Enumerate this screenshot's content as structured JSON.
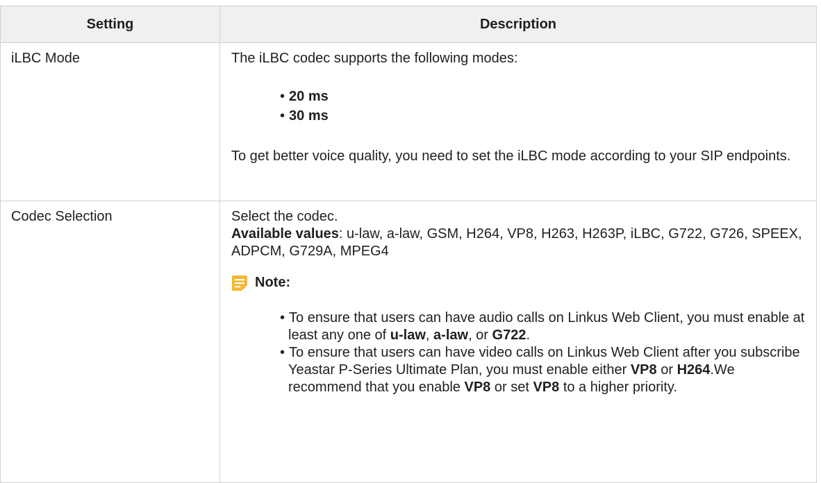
{
  "header": {
    "setting": "Setting",
    "description": "Description"
  },
  "rows": [
    {
      "setting": "iLBC Mode",
      "intro": "The iLBC codec supports the following modes:",
      "modes": [
        "20 ms",
        "30 ms"
      ],
      "after": "To get better voice quality, you need to set the iLBC mode according to your SIP endpoints."
    },
    {
      "setting": "Codec Selection",
      "intro": "Select the codec.",
      "available_label": "Available values",
      "available_values": ": u-law, a-law, GSM, H264, VP8, H263, H263P, iLBC, G722, G726, SPEEX, ADPCM, G729A, MPEG4",
      "note_label": "Note:",
      "note_icon": "note-icon",
      "note_icon_color": "#f5b82e",
      "note1": {
        "t1": "To ensure that users can have audio calls on Linkus Web Client, you must enable at least any one of ",
        "b1": "u-law",
        "t2": ", ",
        "b2": "a-law",
        "t3": ", or ",
        "b3": "G722",
        "t4": "."
      },
      "note2": {
        "t1": "To ensure that users can have video calls on Linkus Web Client after you subscribe Yeastar P-Series Ultimate Plan, you must enable either ",
        "b1": "VP8",
        "t2": " or ",
        "b2": "H264",
        "t3": ".We recommend that you enable ",
        "b3": "VP8",
        "t4": " or set ",
        "b4": "VP8",
        "t5": " to a higher priority."
      }
    }
  ]
}
